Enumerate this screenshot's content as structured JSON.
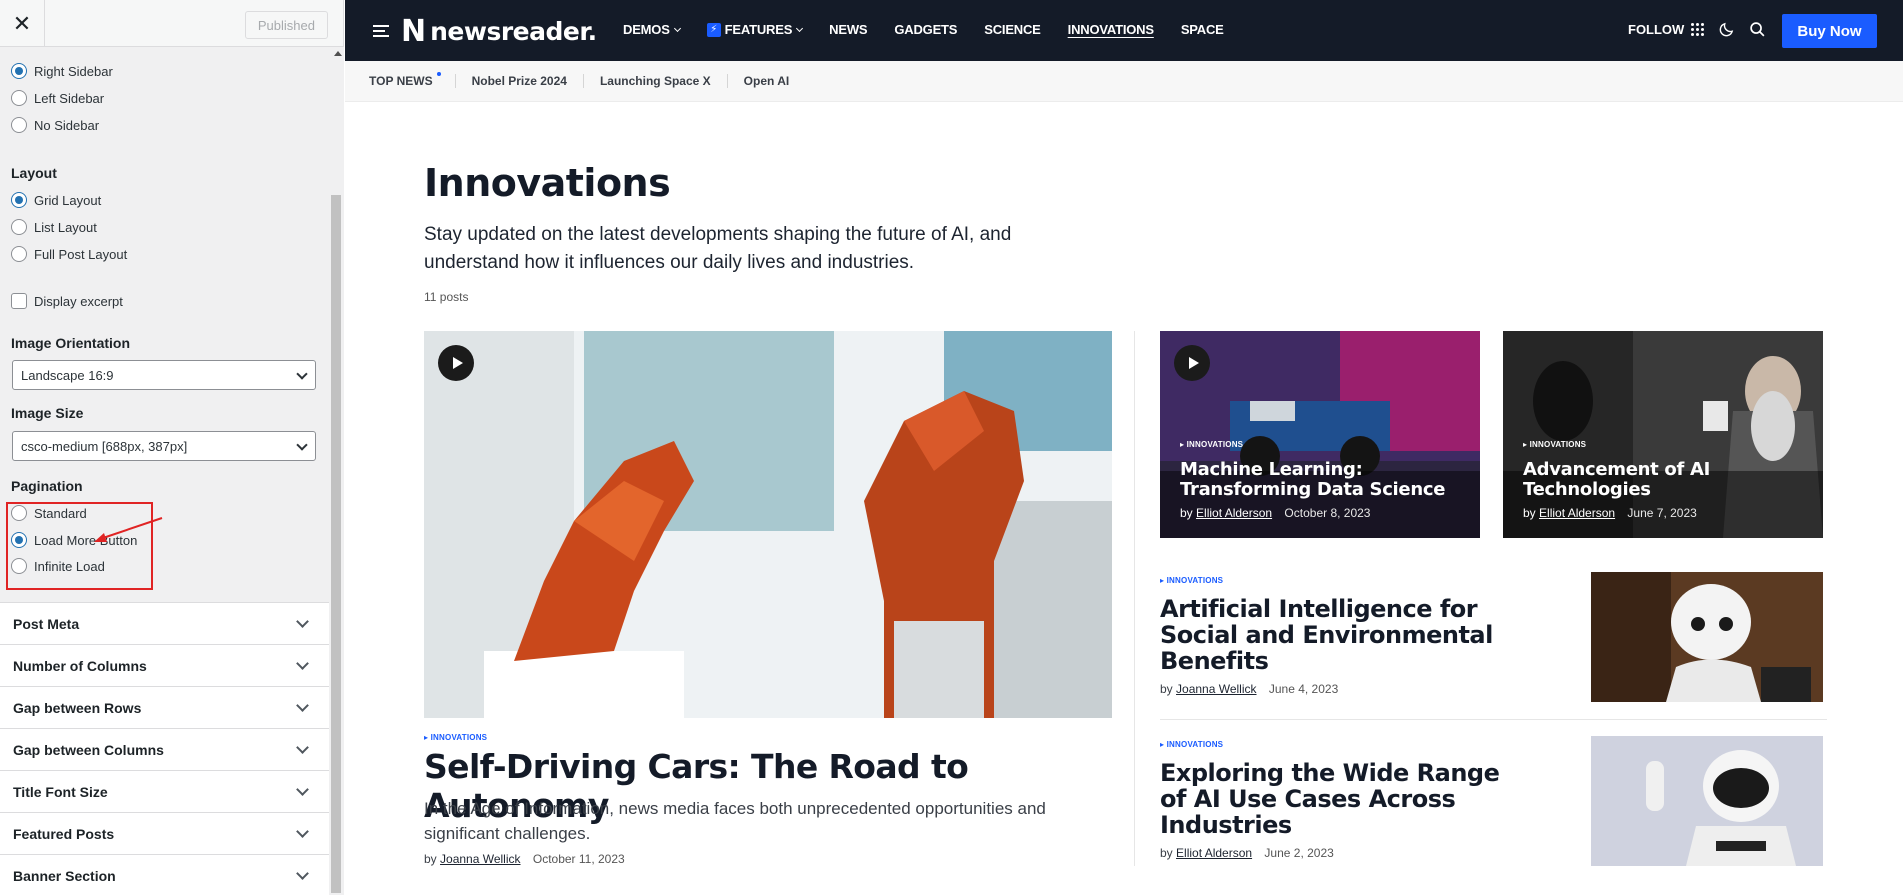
{
  "customizer": {
    "published_label": "Published",
    "close_label": "✕",
    "sidebar_options": [
      "Right Sidebar",
      "Left Sidebar",
      "No Sidebar"
    ],
    "layout": {
      "label": "Layout",
      "options": [
        "Grid Layout",
        "List Layout",
        "Full Post Layout"
      ]
    },
    "display_excerpt": "Display excerpt",
    "image_orientation": {
      "label": "Image Orientation",
      "value": "Landscape 16:9"
    },
    "image_size": {
      "label": "Image Size",
      "value": "csco-medium [688px, 387px]"
    },
    "pagination": {
      "label": "Pagination",
      "options": [
        "Standard",
        "Load More Button",
        "Infinite Load"
      ]
    },
    "sections": [
      "Post Meta",
      "Number of Columns",
      "Gap between Rows",
      "Gap between Columns",
      "Title Font Size",
      "Featured Posts",
      "Banner Section"
    ]
  },
  "site": {
    "logo_name": "newsreader.",
    "nav": [
      "DEMOS",
      "FEATURES",
      "NEWS",
      "GADGETS",
      "SCIENCE",
      "INNOVATIONS",
      "SPACE"
    ],
    "follow": "FOLLOW",
    "buy_now": "Buy Now",
    "ticker": {
      "lead": "TOP NEWS",
      "items": [
        "Nobel Prize 2024",
        "Launching Space X",
        "Open AI"
      ]
    },
    "archive": {
      "title": "Innovations",
      "description": "Stay updated on the latest developments shaping the future of AI, and understand how it influences our daily lives and industries.",
      "count": "11 posts"
    },
    "posts": {
      "main": {
        "category": "▸ INNOVATIONS",
        "title": "Self-Driving Cars: The Road to Autonomy",
        "excerpt": "In the Age of Information, news media faces both unprecedented opportunities and significant challenges.",
        "by": "by",
        "author": "Joanna Wellick",
        "date": "October 11, 2023"
      },
      "card1": {
        "category": "▸ INNOVATIONS",
        "title": "Machine Learning: Transforming Data Science",
        "by": "by",
        "author": "Elliot Alderson",
        "date": "October 8, 2023"
      },
      "card2": {
        "category": "▸ INNOVATIONS",
        "title": "Advancement of AI Technologies",
        "by": "by",
        "author": "Elliot Alderson",
        "date": "June 7, 2023"
      },
      "list1": {
        "category": "▸ INNOVATIONS",
        "title": "Artificial Intelligence for Social and Environmental Benefits",
        "by": "by",
        "author": "Joanna Wellick",
        "date": "June 4, 2023"
      },
      "list2": {
        "category": "▸ INNOVATIONS",
        "title": "Exploring the Wide Range of AI Use Cases Across Industries",
        "by": "by",
        "author": "Elliot Alderson",
        "date": "June 2, 2023"
      }
    }
  },
  "colors": {
    "accent": "#1a5cff",
    "topbar": "#141b28",
    "highlight": "#e02424",
    "wp_blue": "#2271b1"
  }
}
